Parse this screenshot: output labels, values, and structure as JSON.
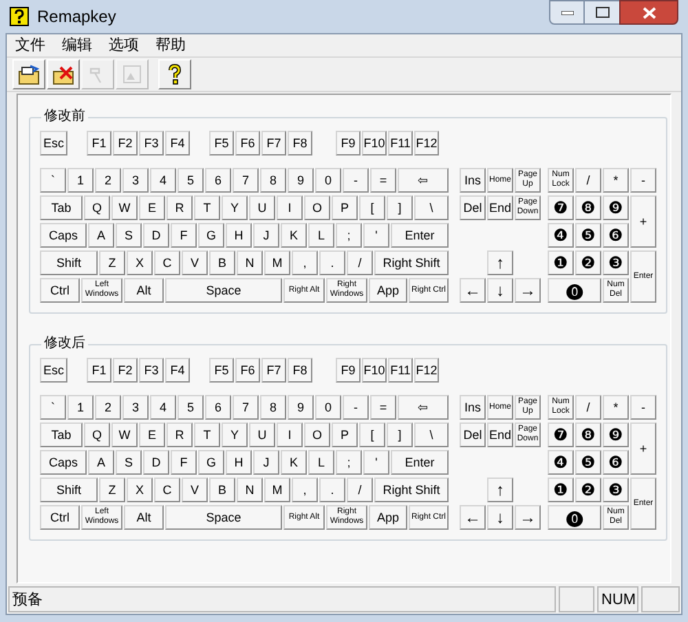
{
  "window": {
    "title": "Remapkey"
  },
  "menu": [
    "文件",
    "编辑",
    "选项",
    "帮助"
  ],
  "toolbar": [
    {
      "disabled": false
    },
    {
      "disabled": false
    },
    {
      "disabled": true
    },
    {
      "disabled": true
    },
    {
      "disabled": false
    }
  ],
  "keyboards": [
    {
      "label": "修改前",
      "function_keys": [
        "Esc",
        "F1",
        "F2",
        "F3",
        "F4",
        "F5",
        "F6",
        "F7",
        "F8",
        "F9",
        "F10",
        "F11",
        "F12"
      ],
      "main_rows": [
        [
          "`",
          "1",
          "2",
          "3",
          "4",
          "5",
          "6",
          "7",
          "8",
          "9",
          "0",
          "-",
          "=",
          "⇦"
        ],
        [
          "Tab",
          "Q",
          "W",
          "E",
          "R",
          "T",
          "Y",
          "U",
          "I",
          "O",
          "P",
          "[",
          "]",
          "\\"
        ],
        [
          "Caps",
          "A",
          "S",
          "D",
          "F",
          "G",
          "H",
          "J",
          "K",
          "L",
          ";",
          "'",
          "Enter"
        ],
        [
          "Shift",
          "Z",
          "X",
          "C",
          "V",
          "B",
          "N",
          "M",
          ",",
          ".",
          "/",
          "Right Shift"
        ],
        [
          "Ctrl",
          "Left\nWindows",
          "Alt",
          "Space",
          "Right Alt",
          "Right\nWindows",
          "App",
          "Right Ctrl"
        ]
      ],
      "nav_keys": [
        "Ins",
        "Home",
        "Page\nUp",
        "Del",
        "End",
        "Page\nDown"
      ],
      "arrow_keys": [
        "↑",
        "←",
        "↓",
        "→"
      ],
      "numpad": [
        "Num\nLock",
        "/",
        "*",
        "-",
        "❼",
        "❽",
        "❾",
        "+",
        "❹",
        "❺",
        "❻",
        "❶",
        "❷",
        "❸",
        "Enter",
        "⓿",
        "Num\nDel"
      ]
    },
    {
      "label": "修改后",
      "function_keys": [
        "Esc",
        "F1",
        "F2",
        "F3",
        "F4",
        "F5",
        "F6",
        "F7",
        "F8",
        "F9",
        "F10",
        "F11",
        "F12"
      ],
      "main_rows": [
        [
          "`",
          "1",
          "2",
          "3",
          "4",
          "5",
          "6",
          "7",
          "8",
          "9",
          "0",
          "-",
          "=",
          "⇦"
        ],
        [
          "Tab",
          "Q",
          "W",
          "E",
          "R",
          "T",
          "Y",
          "U",
          "I",
          "O",
          "P",
          "[",
          "]",
          "\\"
        ],
        [
          "Caps",
          "A",
          "S",
          "D",
          "F",
          "G",
          "H",
          "J",
          "K",
          "L",
          ";",
          "'",
          "Enter"
        ],
        [
          "Shift",
          "Z",
          "X",
          "C",
          "V",
          "B",
          "N",
          "M",
          ",",
          ".",
          "/",
          "Right Shift"
        ],
        [
          "Ctrl",
          "Left\nWindows",
          "Alt",
          "Space",
          "Right Alt",
          "Right\nWindows",
          "App",
          "Right Ctrl"
        ]
      ],
      "nav_keys": [
        "Ins",
        "Home",
        "Page\nUp",
        "Del",
        "End",
        "Page\nDown"
      ],
      "arrow_keys": [
        "↑",
        "←",
        "↓",
        "→"
      ],
      "numpad": [
        "Num\nLock",
        "/",
        "*",
        "-",
        "❼",
        "❽",
        "❾",
        "+",
        "❹",
        "❺",
        "❻",
        "❶",
        "❷",
        "❸",
        "Enter",
        "⓿",
        "Num\nDel"
      ]
    }
  ],
  "status_bar": {
    "text": "预备",
    "indicator": "NUM"
  }
}
